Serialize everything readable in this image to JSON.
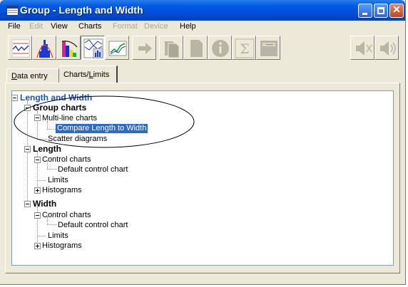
{
  "window": {
    "title": "Group - Length and Width",
    "controls": {
      "minimize": "minimize",
      "maximize": "maximize",
      "close": "✕"
    }
  },
  "menu": {
    "items": [
      {
        "label": "File",
        "enabled": true
      },
      {
        "label": "Edit",
        "enabled": false
      },
      {
        "label": "View",
        "enabled": true
      },
      {
        "label": "Charts",
        "enabled": true
      },
      {
        "label": "Format",
        "enabled": false
      },
      {
        "label": "Device",
        "enabled": false
      },
      {
        "label": "Help",
        "enabled": true
      }
    ]
  },
  "toolbar": {
    "buttons": [
      {
        "icon": "line-chart-icon",
        "pressed": false
      },
      {
        "icon": "histogram-icon",
        "pressed": false
      },
      {
        "icon": "pareto-icon",
        "pressed": false
      },
      {
        "icon": "multi-line-chart-icon",
        "pressed": true
      },
      {
        "icon": "scatter-icon",
        "pressed": false
      },
      {
        "icon": "arrow-right-icon",
        "pressed": false,
        "disabled": true
      },
      {
        "icon": "copy-icon",
        "pressed": false,
        "disabled": true
      },
      {
        "icon": "page-icon",
        "pressed": false,
        "disabled": true
      },
      {
        "icon": "info-icon",
        "pressed": false,
        "disabled": true
      },
      {
        "icon": "sigma-icon",
        "pressed": false,
        "disabled": true
      },
      {
        "icon": "report-icon",
        "pressed": false,
        "disabled": true
      },
      {
        "icon": "speaker-mute-icon",
        "pressed": false,
        "disabled": true
      },
      {
        "icon": "speaker-icon",
        "pressed": false,
        "disabled": true
      }
    ]
  },
  "tabs": [
    {
      "label": "Data entry",
      "active": false
    },
    {
      "label": "Charts/Limits",
      "active": true
    }
  ],
  "tree": {
    "root": "Length and Width",
    "group_charts": "Group charts",
    "multi_line": "Multi-line charts",
    "compare": "Compare Length to Width",
    "scatter": "Scatter diagrams",
    "length": "Length",
    "length_control": "Control charts",
    "length_default": "Default control chart",
    "length_limits": "Limits",
    "length_hist": "Histograms",
    "width": "Width",
    "width_control": "Control charts",
    "width_default": "Default control chart",
    "width_limits": "Limits",
    "width_hist": "Histograms"
  },
  "colors": {
    "selection": "#316ac5",
    "root_text": "#1a4fc0",
    "titlebar": "#0058e6",
    "annotation": "#000000"
  }
}
